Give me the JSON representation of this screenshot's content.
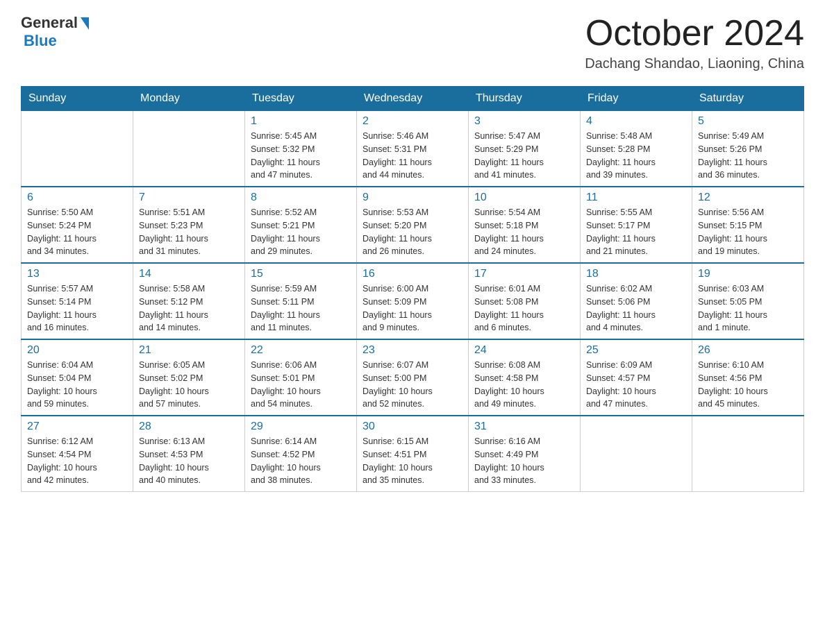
{
  "header": {
    "logo_general": "General",
    "logo_blue": "Blue",
    "month_title": "October 2024",
    "location": "Dachang Shandao, Liaoning, China"
  },
  "weekdays": [
    "Sunday",
    "Monday",
    "Tuesday",
    "Wednesday",
    "Thursday",
    "Friday",
    "Saturday"
  ],
  "weeks": [
    [
      {
        "day": "",
        "info": ""
      },
      {
        "day": "",
        "info": ""
      },
      {
        "day": "1",
        "info": "Sunrise: 5:45 AM\nSunset: 5:32 PM\nDaylight: 11 hours\nand 47 minutes."
      },
      {
        "day": "2",
        "info": "Sunrise: 5:46 AM\nSunset: 5:31 PM\nDaylight: 11 hours\nand 44 minutes."
      },
      {
        "day": "3",
        "info": "Sunrise: 5:47 AM\nSunset: 5:29 PM\nDaylight: 11 hours\nand 41 minutes."
      },
      {
        "day": "4",
        "info": "Sunrise: 5:48 AM\nSunset: 5:28 PM\nDaylight: 11 hours\nand 39 minutes."
      },
      {
        "day": "5",
        "info": "Sunrise: 5:49 AM\nSunset: 5:26 PM\nDaylight: 11 hours\nand 36 minutes."
      }
    ],
    [
      {
        "day": "6",
        "info": "Sunrise: 5:50 AM\nSunset: 5:24 PM\nDaylight: 11 hours\nand 34 minutes."
      },
      {
        "day": "7",
        "info": "Sunrise: 5:51 AM\nSunset: 5:23 PM\nDaylight: 11 hours\nand 31 minutes."
      },
      {
        "day": "8",
        "info": "Sunrise: 5:52 AM\nSunset: 5:21 PM\nDaylight: 11 hours\nand 29 minutes."
      },
      {
        "day": "9",
        "info": "Sunrise: 5:53 AM\nSunset: 5:20 PM\nDaylight: 11 hours\nand 26 minutes."
      },
      {
        "day": "10",
        "info": "Sunrise: 5:54 AM\nSunset: 5:18 PM\nDaylight: 11 hours\nand 24 minutes."
      },
      {
        "day": "11",
        "info": "Sunrise: 5:55 AM\nSunset: 5:17 PM\nDaylight: 11 hours\nand 21 minutes."
      },
      {
        "day": "12",
        "info": "Sunrise: 5:56 AM\nSunset: 5:15 PM\nDaylight: 11 hours\nand 19 minutes."
      }
    ],
    [
      {
        "day": "13",
        "info": "Sunrise: 5:57 AM\nSunset: 5:14 PM\nDaylight: 11 hours\nand 16 minutes."
      },
      {
        "day": "14",
        "info": "Sunrise: 5:58 AM\nSunset: 5:12 PM\nDaylight: 11 hours\nand 14 minutes."
      },
      {
        "day": "15",
        "info": "Sunrise: 5:59 AM\nSunset: 5:11 PM\nDaylight: 11 hours\nand 11 minutes."
      },
      {
        "day": "16",
        "info": "Sunrise: 6:00 AM\nSunset: 5:09 PM\nDaylight: 11 hours\nand 9 minutes."
      },
      {
        "day": "17",
        "info": "Sunrise: 6:01 AM\nSunset: 5:08 PM\nDaylight: 11 hours\nand 6 minutes."
      },
      {
        "day": "18",
        "info": "Sunrise: 6:02 AM\nSunset: 5:06 PM\nDaylight: 11 hours\nand 4 minutes."
      },
      {
        "day": "19",
        "info": "Sunrise: 6:03 AM\nSunset: 5:05 PM\nDaylight: 11 hours\nand 1 minute."
      }
    ],
    [
      {
        "day": "20",
        "info": "Sunrise: 6:04 AM\nSunset: 5:04 PM\nDaylight: 10 hours\nand 59 minutes."
      },
      {
        "day": "21",
        "info": "Sunrise: 6:05 AM\nSunset: 5:02 PM\nDaylight: 10 hours\nand 57 minutes."
      },
      {
        "day": "22",
        "info": "Sunrise: 6:06 AM\nSunset: 5:01 PM\nDaylight: 10 hours\nand 54 minutes."
      },
      {
        "day": "23",
        "info": "Sunrise: 6:07 AM\nSunset: 5:00 PM\nDaylight: 10 hours\nand 52 minutes."
      },
      {
        "day": "24",
        "info": "Sunrise: 6:08 AM\nSunset: 4:58 PM\nDaylight: 10 hours\nand 49 minutes."
      },
      {
        "day": "25",
        "info": "Sunrise: 6:09 AM\nSunset: 4:57 PM\nDaylight: 10 hours\nand 47 minutes."
      },
      {
        "day": "26",
        "info": "Sunrise: 6:10 AM\nSunset: 4:56 PM\nDaylight: 10 hours\nand 45 minutes."
      }
    ],
    [
      {
        "day": "27",
        "info": "Sunrise: 6:12 AM\nSunset: 4:54 PM\nDaylight: 10 hours\nand 42 minutes."
      },
      {
        "day": "28",
        "info": "Sunrise: 6:13 AM\nSunset: 4:53 PM\nDaylight: 10 hours\nand 40 minutes."
      },
      {
        "day": "29",
        "info": "Sunrise: 6:14 AM\nSunset: 4:52 PM\nDaylight: 10 hours\nand 38 minutes."
      },
      {
        "day": "30",
        "info": "Sunrise: 6:15 AM\nSunset: 4:51 PM\nDaylight: 10 hours\nand 35 minutes."
      },
      {
        "day": "31",
        "info": "Sunrise: 6:16 AM\nSunset: 4:49 PM\nDaylight: 10 hours\nand 33 minutes."
      },
      {
        "day": "",
        "info": ""
      },
      {
        "day": "",
        "info": ""
      }
    ]
  ]
}
